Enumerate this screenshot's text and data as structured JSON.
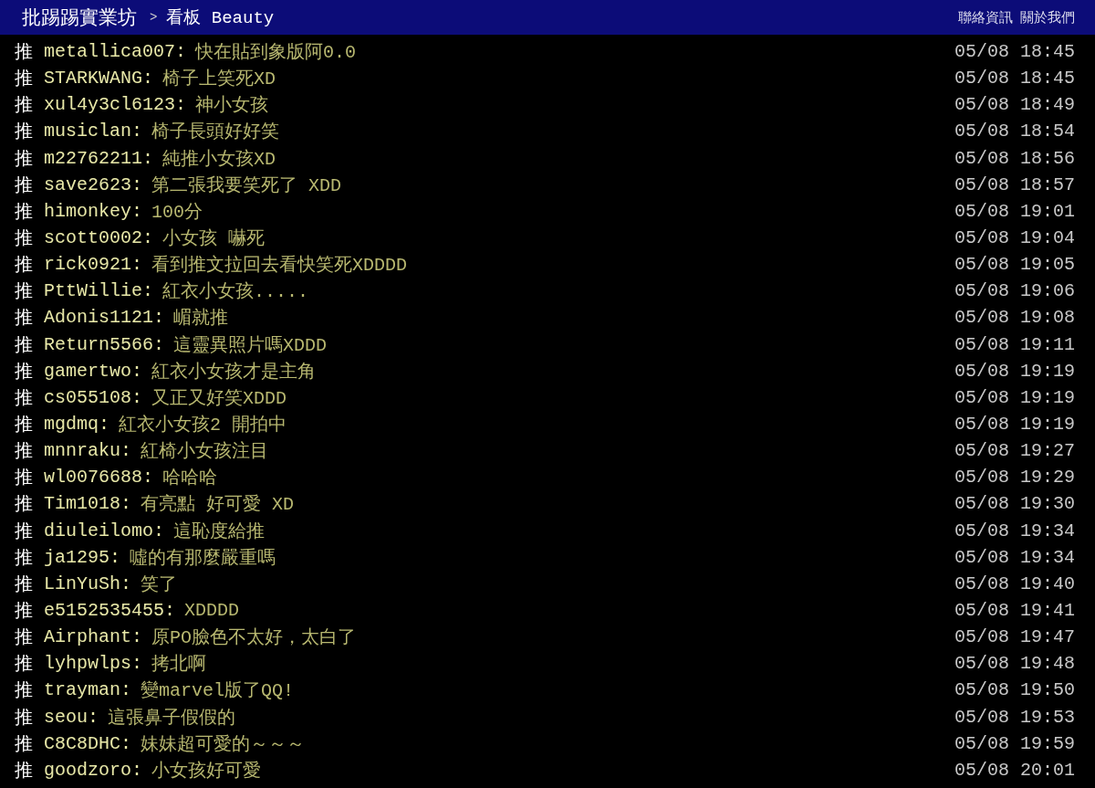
{
  "header": {
    "site": "批踢踢實業坊",
    "separator": ">",
    "board": "看板 Beauty",
    "links": [
      "聯絡資訊",
      "關於我們"
    ]
  },
  "pushes": [
    {
      "tag": "推",
      "user": "metallica007:",
      "content": "快在貼到象版阿0.0",
      "time": "05/08 18:45"
    },
    {
      "tag": "推",
      "user": "STARKWANG:",
      "content": "椅子上笑死XD",
      "time": "05/08 18:45"
    },
    {
      "tag": "推",
      "user": "xul4y3cl6123:",
      "content": "神小女孩",
      "time": "05/08 18:49"
    },
    {
      "tag": "推",
      "user": "musiclan:",
      "content": "椅子長頭好好笑",
      "time": "05/08 18:54"
    },
    {
      "tag": "推",
      "user": "m22762211:",
      "content": "純推小女孩XD",
      "time": "05/08 18:56"
    },
    {
      "tag": "推",
      "user": "save2623:",
      "content": "第二張我要笑死了 XDD",
      "time": "05/08 18:57"
    },
    {
      "tag": "推",
      "user": "himonkey:",
      "content": "100分",
      "time": "05/08 19:01"
    },
    {
      "tag": "推",
      "user": "scott0002:",
      "content": "小女孩 嚇死",
      "time": "05/08 19:04"
    },
    {
      "tag": "推",
      "user": "rick0921:",
      "content": "看到推文拉回去看快笑死XDDDD",
      "time": "05/08 19:05"
    },
    {
      "tag": "推",
      "user": "PttWillie:",
      "content": "紅衣小女孩.....",
      "time": "05/08 19:06"
    },
    {
      "tag": "推",
      "user": "Adonis1121:",
      "content": "嵋就推",
      "time": "05/08 19:08"
    },
    {
      "tag": "推",
      "user": "Return5566:",
      "content": "這靈異照片嗎XDDD",
      "time": "05/08 19:11"
    },
    {
      "tag": "推",
      "user": "gamertwo:",
      "content": "紅衣小女孩才是主角",
      "time": "05/08 19:19"
    },
    {
      "tag": "推",
      "user": "cs055108:",
      "content": "又正又好笑XDDD",
      "time": "05/08 19:19"
    },
    {
      "tag": "推",
      "user": "mgdmq:",
      "content": "紅衣小女孩2  開拍中",
      "time": "05/08 19:19"
    },
    {
      "tag": "推",
      "user": "mnnraku:",
      "content": "紅椅小女孩注目",
      "time": "05/08 19:27"
    },
    {
      "tag": "推",
      "user": "wl0076688:",
      "content": "哈哈哈",
      "time": "05/08 19:29"
    },
    {
      "tag": "推",
      "user": "Tim1018:",
      "content": "有亮點 好可愛 XD",
      "time": "05/08 19:30"
    },
    {
      "tag": "推",
      "user": "diuleilomo:",
      "content": "這恥度給推",
      "time": "05/08 19:34"
    },
    {
      "tag": "推",
      "user": "ja1295:",
      "content": "噓的有那麼嚴重嗎",
      "time": "05/08 19:34"
    },
    {
      "tag": "推",
      "user": "LinYuSh:",
      "content": "笑了",
      "time": "05/08 19:40"
    },
    {
      "tag": "推",
      "user": "e5152535455:",
      "content": "XDDDD",
      "time": "05/08 19:41"
    },
    {
      "tag": "推",
      "user": "Airphant:",
      "content": "原PO臉色不太好，太白了",
      "time": "05/08 19:47"
    },
    {
      "tag": "推",
      "user": "lyhpwlps:",
      "content": "拷北啊",
      "time": "05/08 19:48"
    },
    {
      "tag": "推",
      "user": "trayman:",
      "content": "變marvel版了QQ!",
      "time": "05/08 19:50"
    },
    {
      "tag": "推",
      "user": "seou:",
      "content": "這張鼻子假假的",
      "time": "05/08 19:53"
    },
    {
      "tag": "推",
      "user": "C8C8DHC:",
      "content": "妹妹超可愛的～～～",
      "time": "05/08 19:59"
    },
    {
      "tag": "推",
      "user": "goodzoro:",
      "content": "小女孩好可愛",
      "time": "05/08 20:01"
    }
  ]
}
